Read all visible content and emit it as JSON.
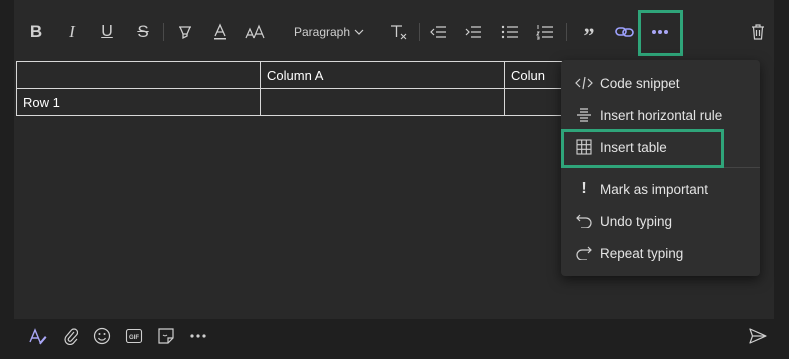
{
  "toolbar": {
    "paragraph_label": "Paragraph",
    "icons": [
      "bold-icon",
      "italic-icon",
      "underline-icon",
      "strikethrough-icon",
      "highlight-icon",
      "font-color-icon",
      "font-size-icon",
      "paragraph-style-dropdown",
      "clear-formatting-icon",
      "decrease-indent-icon",
      "increase-indent-icon",
      "bulleted-list-icon",
      "numbered-list-icon",
      "quote-icon",
      "link-icon",
      "more-options-icon",
      "delete-icon"
    ]
  },
  "table": {
    "header": [
      "",
      "Column A",
      "Colun"
    ],
    "row1": [
      "Row 1",
      "",
      ""
    ]
  },
  "menu": {
    "items": [
      {
        "label": "Code snippet",
        "icon": "code-icon"
      },
      {
        "label": "Insert horizontal rule",
        "icon": "horizontal-rule-icon"
      },
      {
        "label": "Insert table",
        "icon": "table-icon"
      },
      {
        "label": "Mark as important",
        "icon": "exclamation-icon"
      },
      {
        "label": "Undo typing",
        "icon": "undo-icon"
      },
      {
        "label": "Repeat typing",
        "icon": "redo-icon"
      }
    ]
  },
  "bottom_bar": {
    "icons": [
      "format-icon",
      "attach-icon",
      "emoji-icon",
      "gif-icon",
      "sticker-icon",
      "more-icon",
      "send-icon"
    ]
  },
  "colors": {
    "highlight": "#2fa57a",
    "link_accent": "#9ea2ff",
    "more_accent": "#a9a6f5"
  }
}
